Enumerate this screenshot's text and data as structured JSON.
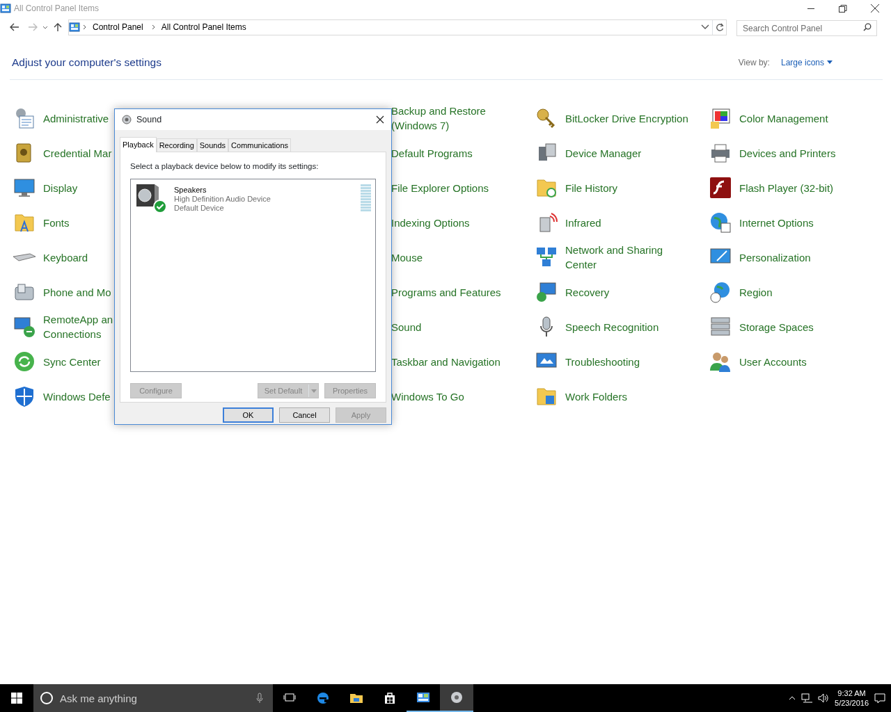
{
  "window": {
    "title": "All Control Panel Items"
  },
  "address": {
    "crumbs": [
      "Control Panel",
      "All Control Panel Items"
    ]
  },
  "search": {
    "placeholder": "Search Control Panel"
  },
  "heading": "Adjust your computer's settings",
  "view_by": {
    "label": "View by:",
    "value": "Large icons"
  },
  "columns": [
    [
      {
        "label": "Administrative"
      },
      {
        "label": "Credential Mar"
      },
      {
        "label": "Display"
      },
      {
        "label": "Fonts"
      },
      {
        "label": "Keyboard"
      },
      {
        "label": "Phone and Mo"
      },
      {
        "label": "RemoteApp an\nConnections"
      },
      {
        "label": "Sync Center"
      },
      {
        "label": "Windows Defe"
      }
    ],
    [
      {
        "label": "Backup and Restore\n(Windows 7)"
      },
      {
        "label": "Default Programs"
      },
      {
        "label": "File Explorer Options"
      },
      {
        "label": "Indexing Options"
      },
      {
        "label": "Mouse"
      },
      {
        "label": "Programs and Features"
      },
      {
        "label": "Sound"
      },
      {
        "label": "Taskbar and Navigation"
      },
      {
        "label": "Windows To Go"
      }
    ],
    [
      {
        "label": "BitLocker Drive Encryption"
      },
      {
        "label": "Device Manager"
      },
      {
        "label": "File History"
      },
      {
        "label": "Infrared"
      },
      {
        "label": "Network and Sharing\nCenter"
      },
      {
        "label": "Recovery"
      },
      {
        "label": "Speech Recognition"
      },
      {
        "label": "Troubleshooting"
      },
      {
        "label": "Work Folders"
      }
    ],
    [
      {
        "label": "Color Management"
      },
      {
        "label": "Devices and Printers"
      },
      {
        "label": "Flash Player (32-bit)"
      },
      {
        "label": "Internet Options"
      },
      {
        "label": "Personalization"
      },
      {
        "label": "Region"
      },
      {
        "label": "Storage Spaces"
      },
      {
        "label": "User Accounts"
      }
    ]
  ],
  "dialog": {
    "title": "Sound",
    "tabs": [
      {
        "label": "Playback",
        "selected": true
      },
      {
        "label": "Recording",
        "selected": false
      },
      {
        "label": "Sounds",
        "selected": false
      },
      {
        "label": "Communications",
        "selected": false
      }
    ],
    "instruction": "Select a playback device below to modify its settings:",
    "devices": [
      {
        "name": "Speakers",
        "description": "High Definition Audio Device",
        "status": "Default Device",
        "is_default": true
      }
    ],
    "left_buttons": [
      {
        "label": "Configure",
        "disabled": true
      }
    ],
    "split_button": {
      "label": "Set Default",
      "disabled": true
    },
    "right_buttons": [
      {
        "label": "Properties",
        "disabled": true
      }
    ],
    "footer_buttons": [
      {
        "label": "OK",
        "disabled": false,
        "default": true
      },
      {
        "label": "Cancel",
        "disabled": false,
        "default": false
      },
      {
        "label": "Apply",
        "disabled": true,
        "default": false
      }
    ]
  },
  "taskbar": {
    "search_placeholder": "Ask me anything",
    "apps": [
      {
        "running": false,
        "active": false
      },
      {
        "running": false,
        "active": false
      },
      {
        "running": false,
        "active": false
      },
      {
        "running": false,
        "active": false
      },
      {
        "running": true,
        "active": false
      },
      {
        "running": true,
        "active": true
      }
    ],
    "time": "9:32 AM",
    "date": "5/23/2016"
  }
}
